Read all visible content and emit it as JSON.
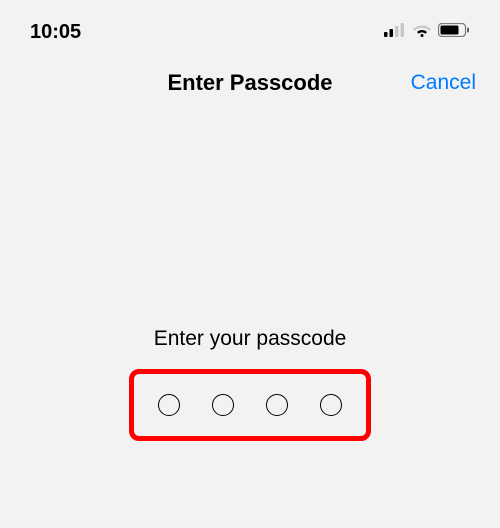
{
  "status_bar": {
    "time": "10:05"
  },
  "nav": {
    "title": "Enter Passcode",
    "cancel_label": "Cancel"
  },
  "content": {
    "prompt": "Enter your passcode",
    "passcode_length": 4
  },
  "colors": {
    "accent": "#007aff",
    "highlight_border": "#ff0000",
    "background": "#f2f2f3"
  }
}
